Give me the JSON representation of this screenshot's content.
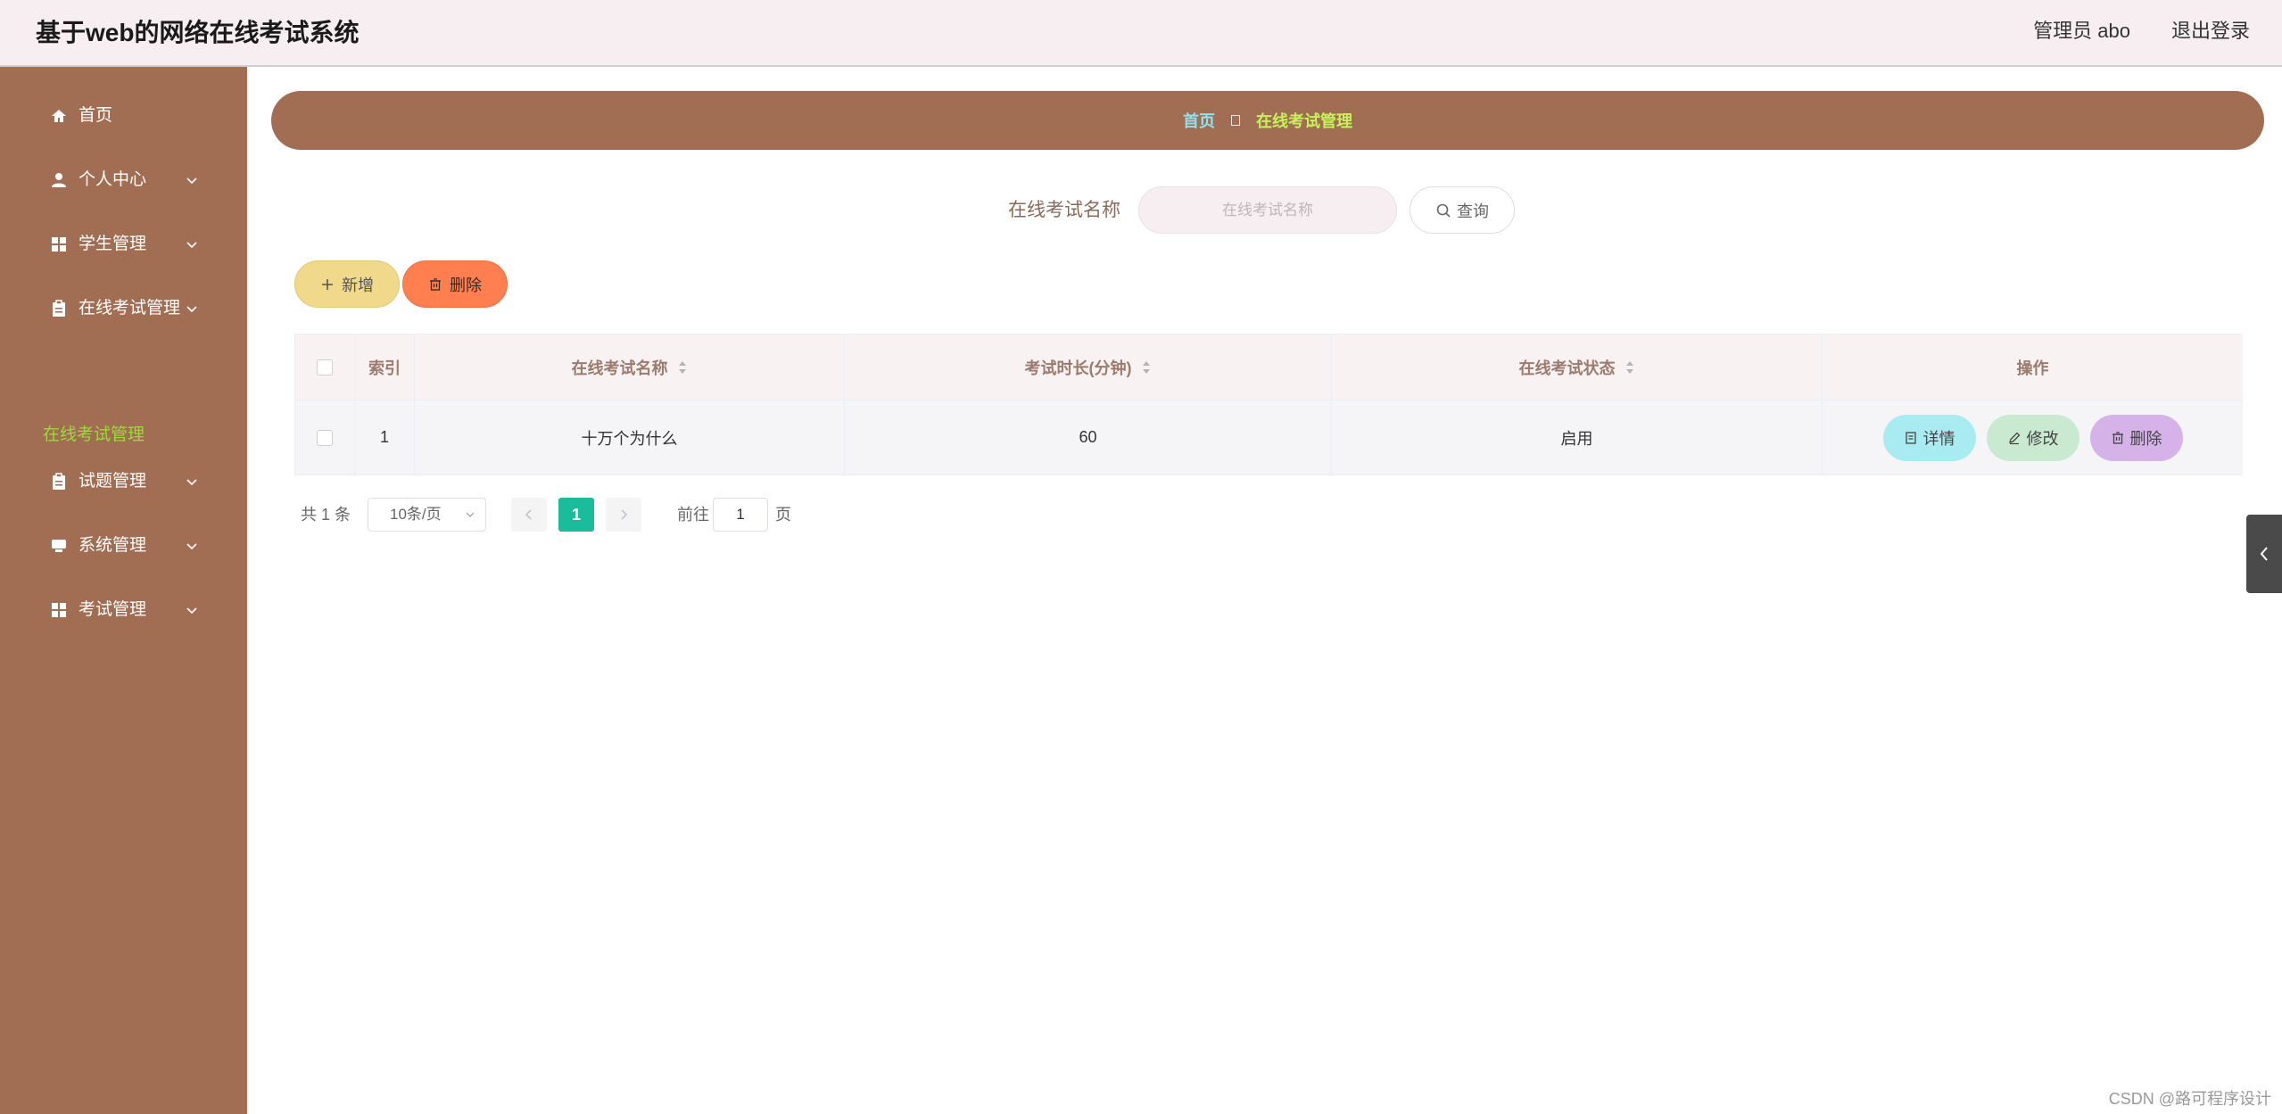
{
  "header": {
    "title": "基于web的网络在线考试系统",
    "user": "管理员 abo",
    "logout": "退出登录"
  },
  "sidebar": {
    "items": [
      {
        "label": "首页",
        "icon": "home-icon"
      },
      {
        "label": "个人中心",
        "icon": "user-icon"
      },
      {
        "label": "学生管理",
        "icon": "grid-icon"
      },
      {
        "label": "在线考试管理",
        "icon": "clipboard-icon"
      },
      {
        "label": "试题管理",
        "icon": "clipboard-icon"
      },
      {
        "label": "系统管理",
        "icon": "server-icon"
      },
      {
        "label": "考试管理",
        "icon": "grid-icon"
      }
    ],
    "active_sub": "在线考试管理"
  },
  "breadcrumb": {
    "home": "首页",
    "current": "在线考试管理"
  },
  "search": {
    "label": "在线考试名称",
    "placeholder": "在线考试名称",
    "button": "查询"
  },
  "toolbar": {
    "add": "新增",
    "delete": "删除"
  },
  "table": {
    "columns": [
      "索引",
      "在线考试名称",
      "考试时长(分钟)",
      "在线考试状态",
      "操作"
    ],
    "rows": [
      {
        "index": "1",
        "name": "十万个为什么",
        "duration": "60",
        "status": "启用"
      }
    ],
    "actions": {
      "detail": "详情",
      "edit": "修改",
      "delete": "删除"
    }
  },
  "pagination": {
    "total": "共 1 条",
    "page_size": "10条/页",
    "current": "1",
    "goto_label": "前往",
    "goto_value": "1",
    "goto_unit": "页"
  },
  "watermark": "CSDN @路可程序设计",
  "colors": {
    "sidebar_bg": "#a26e53",
    "active_green": "#9adb3a",
    "pager_active": "#1abc9c",
    "add_btn": "#f0d98a",
    "delete_btn": "#ff7f50"
  }
}
